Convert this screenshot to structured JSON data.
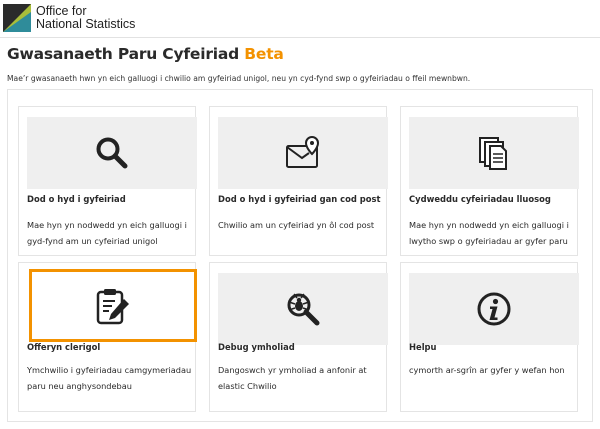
{
  "header": {
    "logo_line1": "Office for",
    "logo_line2": "National Statistics"
  },
  "page": {
    "title": "Gwasanaeth Paru Cyfeiriad",
    "beta": "Beta",
    "intro": "Mae’r gwasanaeth hwn yn eich galluogi i chwilio am gyfeiriad unigol, neu yn cyd-fynd swp o gyfeiriadau o ffeil mewnbwn."
  },
  "cards": [
    {
      "icon": "magnifier-icon",
      "title": "Dod o hyd i gyfeiriad",
      "desc": "Mae hyn yn nodwedd yn eich galluogi i gyd-fynd am un cyfeiriad unigol"
    },
    {
      "icon": "envelope-pin-icon",
      "title": "Dod o hyd i gyfeiriad gan cod post",
      "desc": "Chwilio am un cyfeiriad yn ôl cod post"
    },
    {
      "icon": "documents-icon",
      "title": "Cydweddu cyfeiriadau lluosog",
      "desc": "Mae hyn yn nodwedd yn eich galluogi i lwytho swp o gyfeiriadau ar gyfer paru"
    },
    {
      "icon": "clipboard-pencil-icon",
      "title": "Offeryn clerigol",
      "desc": "Ymchwilio i gyfeiriadau camgymeriadau paru neu anghysondebau"
    },
    {
      "icon": "bug-magnifier-icon",
      "title": "Debug ymholiad",
      "desc": "Dangoswch yr ymholiad a anfonir at elastic Chwilio"
    },
    {
      "icon": "info-icon",
      "title": "Helpu",
      "desc": "cymorth ar-sgrîn ar gyfer y wefan hon"
    }
  ],
  "colors": {
    "accent": "#f39200",
    "logo_green": "#a8bd3a",
    "logo_dark": "#2b2b2b"
  }
}
